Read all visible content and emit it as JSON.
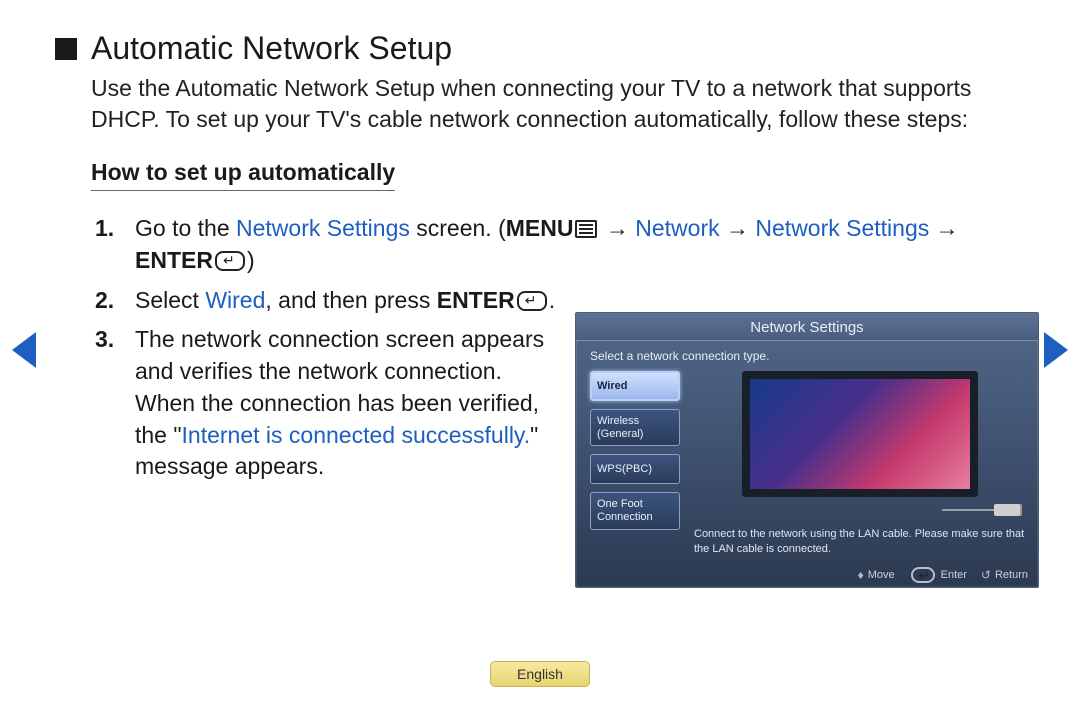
{
  "title": "Automatic Network Setup",
  "intro": "Use the Automatic Network Setup when connecting your TV to a network that supports DHCP. To set up your TV's cable network connection automatically, follow these steps:",
  "how_heading": "How to set up automatically",
  "steps": {
    "s1": {
      "t1": "Go to the ",
      "b1": "Network Settings",
      "t2": " screen. (",
      "menu": "MENU",
      "arrow": " → ",
      "b2": "Network",
      "b3": "Network Settings",
      "enter": "ENTER",
      "close": ")"
    },
    "s2": {
      "t1": "Select ",
      "b1": "Wired",
      "t2": ", and then press ",
      "enter": "ENTER",
      "t3": "."
    },
    "s3": {
      "t1": "The network connection screen appears and verifies the network connection. When the connection has been verified, the \"",
      "b1": "Internet is connected successfully.",
      "t2": "\" message appears."
    }
  },
  "panel": {
    "title": "Network Settings",
    "subtitle": "Select a network connection type.",
    "buttons": {
      "wired": "Wired",
      "wireless": "Wireless (General)",
      "wps": "WPS(PBC)",
      "onefoot": "One Foot Connection"
    },
    "desc": "Connect to the network using the LAN cable. Please make sure that the LAN cable is connected.",
    "foot": {
      "move": "Move",
      "enter": "Enter",
      "return": "Return"
    }
  },
  "language": "English"
}
